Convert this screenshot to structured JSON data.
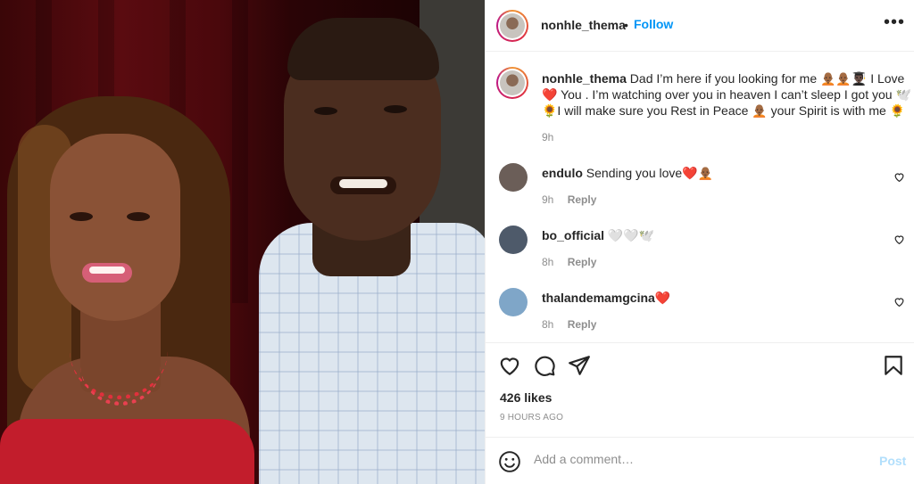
{
  "post": {
    "author": "nonhle_thema",
    "follow_label": "Follow",
    "separator": "•",
    "more_label": "•••"
  },
  "caption": {
    "username": "nonhle_thema",
    "text": "Dad I’m here if you looking for me 🧑🏾‍🦲🧑🏾‍🦲👨🏿‍🎓 I Love❤️ You . I’m watching over you in heaven I can’t sleep I got you 🕊️🌻I will make sure you Rest in Peace 🧑🏾‍🦲 your Spirit is with me 🌻",
    "time": "9h"
  },
  "comments": [
    {
      "username": "endulo",
      "text": "Sending you love❤️🧑🏾‍🦲",
      "time": "9h",
      "reply_label": "Reply",
      "avatar_color": "#6b5e58"
    },
    {
      "username": "bo_official",
      "text": "🤍🤍🕊️",
      "time": "8h",
      "reply_label": "Reply",
      "avatar_color": "#4e5a6a"
    },
    {
      "username": "thalandemamgcina",
      "text": "❤️",
      "time": "8h",
      "reply_label": "Reply",
      "avatar_color": "#7fa6c8"
    }
  ],
  "stats": {
    "likes": "426 likes",
    "time_ago": "9 HOURS AGO"
  },
  "add_comment": {
    "placeholder": "Add a comment…",
    "post_label": "Post"
  },
  "icons": {
    "like": "heart-icon",
    "comment": "comment-icon",
    "share": "share-icon",
    "save": "bookmark-icon",
    "emoji": "emoji-icon",
    "more": "more-icon"
  },
  "colors": {
    "accent": "#0095f6",
    "post_disabled": "#b2dffc",
    "muted": "#8e8e8e"
  }
}
